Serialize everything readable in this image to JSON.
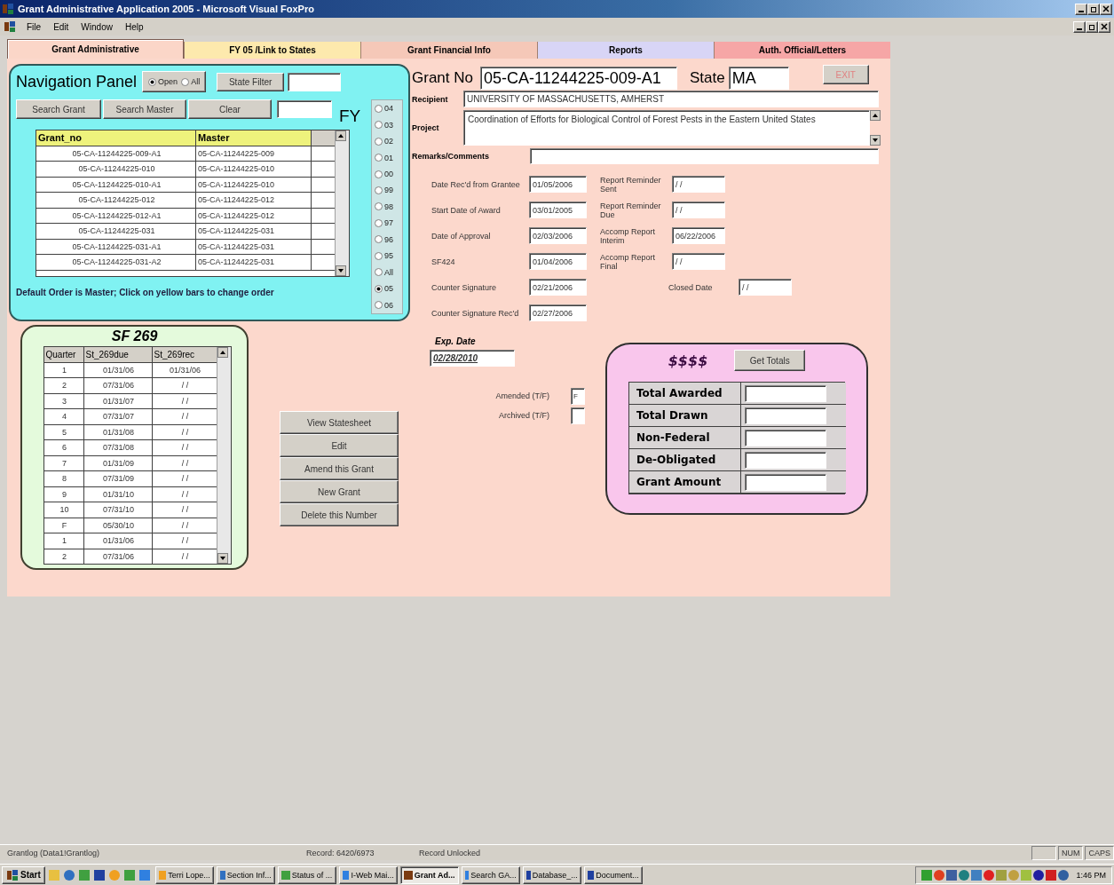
{
  "window": {
    "title": "Grant Administrative Application 2005 - Microsoft Visual FoxPro"
  },
  "menu": [
    "File",
    "Edit",
    "Window",
    "Help"
  ],
  "tabs": [
    {
      "label": "Grant Administrative",
      "selected": true,
      "color": "#fbd6c8"
    },
    {
      "label": "FY 05 /Link to States",
      "selected": false,
      "color": "#fde9ad"
    },
    {
      "label": "Grant Financial Info",
      "selected": false,
      "color": "#f5c8b8"
    },
    {
      "label": "Reports",
      "selected": false,
      "color": "#d8d5f6"
    },
    {
      "label": "Auth. Official/Letters",
      "selected": false,
      "color": "#f6a6a6"
    }
  ],
  "navigation": {
    "title": "Navigation Panel",
    "status_options": [
      {
        "label": "Open",
        "selected": true
      },
      {
        "label": "All",
        "selected": false
      }
    ],
    "state_filter_button": "State Filter",
    "buttons": [
      "Search Grant",
      "Search Master",
      "Clear"
    ],
    "fy_label": "FY",
    "fy_options": [
      {
        "label": "04",
        "selected": false
      },
      {
        "label": "03",
        "selected": false
      },
      {
        "label": "02",
        "selected": false
      },
      {
        "label": "01",
        "selected": false
      },
      {
        "label": "00",
        "selected": false
      },
      {
        "label": "99",
        "selected": false
      },
      {
        "label": "98",
        "selected": false
      },
      {
        "label": "97",
        "selected": false
      },
      {
        "label": "96",
        "selected": false
      },
      {
        "label": "95",
        "selected": false
      },
      {
        "label": "All",
        "selected": false
      },
      {
        "label": "05",
        "selected": true
      },
      {
        "label": "06",
        "selected": false
      }
    ],
    "grid": {
      "columns": [
        "Grant_no",
        "Master"
      ],
      "rows": [
        [
          "05-CA-11244225-009-A1",
          "05-CA-11244225-009"
        ],
        [
          "05-CA-11244225-010",
          "05-CA-11244225-010"
        ],
        [
          "05-CA-11244225-010-A1",
          "05-CA-11244225-010"
        ],
        [
          "05-CA-11244225-012",
          "05-CA-11244225-012"
        ],
        [
          "05-CA-11244225-012-A1",
          "05-CA-11244225-012"
        ],
        [
          "05-CA-11244225-031",
          "05-CA-11244225-031"
        ],
        [
          "05-CA-11244225-031-A1",
          "05-CA-11244225-031"
        ],
        [
          "05-CA-11244225-031-A2",
          "05-CA-11244225-031"
        ]
      ]
    },
    "hint": "Default Order is Master; Click on yellow bars to change order"
  },
  "sf269": {
    "title": "SF 269",
    "columns": [
      "Quarter",
      "St_269due",
      "St_269rec"
    ],
    "rows": [
      [
        "1",
        "01/31/06",
        "01/31/06"
      ],
      [
        "2",
        "07/31/06",
        "/ /"
      ],
      [
        "3",
        "01/31/07",
        "/ /"
      ],
      [
        "4",
        "07/31/07",
        "/ /"
      ],
      [
        "5",
        "01/31/08",
        "/ /"
      ],
      [
        "6",
        "07/31/08",
        "/ /"
      ],
      [
        "7",
        "01/31/09",
        "/ /"
      ],
      [
        "8",
        "07/31/09",
        "/ /"
      ],
      [
        "9",
        "01/31/10",
        "/ /"
      ],
      [
        "10",
        "07/31/10",
        "/ /"
      ],
      [
        "F",
        "05/30/10",
        "/ /"
      ],
      [
        "1",
        "01/31/06",
        "/ /"
      ],
      [
        "2",
        "07/31/06",
        "/ /"
      ]
    ]
  },
  "actions": [
    "View Statesheet",
    "Edit",
    "Amend this Grant",
    "New Grant",
    "Delete this Number"
  ],
  "grant": {
    "grant_no_label": "Grant No",
    "grant_no": "05-CA-11244225-009-A1",
    "state_label": "State",
    "state": "MA",
    "exit_button": "EXIT",
    "recipient_label": "Recipient",
    "recipient": "UNIVERSITY OF MASSACHUSETTS, AMHERST",
    "project_label": "Project",
    "project": "Coordination of Efforts for Biological Control of Forest Pests in the Eastern United States",
    "remarks_label": "Remarks/Comments"
  },
  "dates": [
    {
      "label": "Date Rec'd from Grantee",
      "value": "01/05/2006",
      "side_label": "Report Reminder Sent",
      "side_value": "/ /"
    },
    {
      "label": "Start Date of Award",
      "value": "03/01/2005",
      "side_label": "Report Reminder Due",
      "side_value": "/ /"
    },
    {
      "label": "Date of Approval",
      "value": "02/03/2006",
      "side_label": "Accomp Report Interim",
      "side_value": "06/22/2006"
    },
    {
      "label": "SF424",
      "value": "01/04/2006",
      "side_label": "Accomp Report Final",
      "side_value": "/ /"
    },
    {
      "label": "Counter Signature",
      "value": "02/21/2006",
      "closed_label": "Closed Date",
      "closed_value": "/ /"
    },
    {
      "label": "Counter Signature Rec'd",
      "value": "02/27/2006"
    }
  ],
  "expiration": {
    "label": "Exp. Date",
    "value": "02/28/2010"
  },
  "flags": [
    {
      "label": "Amended (T/F)",
      "value": "F"
    },
    {
      "label": "Archived (T/F)"
    }
  ],
  "totals": {
    "title": "$$$$",
    "button": "Get Totals",
    "rows": [
      "Total Awarded",
      "Total Drawn",
      "Non-Federal",
      "De-Obligated",
      "Grant Amount"
    ]
  },
  "status_bar": {
    "sections": [
      "Grantlog (Data1!Grantlog)",
      "Record: 6420/6973",
      "Record Unlocked"
    ],
    "indicators": [
      "NUM",
      "CAPS"
    ]
  },
  "taskbar": {
    "start": "Start",
    "tasks": [
      {
        "label": "Terri Lope...",
        "selected": false
      },
      {
        "label": "Section Inf...",
        "selected": false
      },
      {
        "label": "Status of ...",
        "selected": false
      },
      {
        "label": "I-Web Mai...",
        "selected": false
      },
      {
        "label": "Grant Ad...",
        "selected": true
      },
      {
        "label": "Search GA...",
        "selected": false
      },
      {
        "label": "Database_...",
        "selected": false
      },
      {
        "label": "Document...",
        "selected": false
      }
    ],
    "clock": "1:46 PM"
  }
}
